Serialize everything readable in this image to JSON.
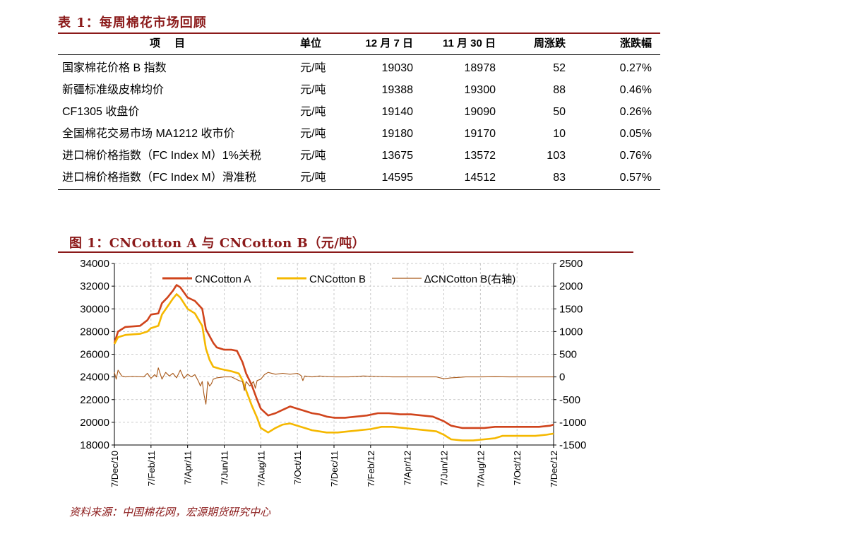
{
  "table": {
    "title": "表 1：每周棉花市场回顾",
    "headers": [
      "项目",
      "单位",
      "12 月 7 日",
      "11 月 30 日",
      "周涨跌",
      "涨跌幅"
    ],
    "rows": [
      [
        "国家棉花价格 B 指数",
        "元/吨",
        "19030",
        "18978",
        "52",
        "0.27%"
      ],
      [
        "新疆标准级皮棉均价",
        "元/吨",
        "19388",
        "19300",
        "88",
        "0.46%"
      ],
      [
        "CF1305 收盘价",
        "元/吨",
        "19140",
        "19090",
        "50",
        "0.26%"
      ],
      [
        "全国棉花交易市场 MA1212 收市价",
        "元/吨",
        "19180",
        "19170",
        "10",
        "0.05%"
      ],
      [
        "进口棉价格指数（FC Index M）1%关税",
        "元/吨",
        "13675",
        "13572",
        "103",
        "0.76%"
      ],
      [
        "进口棉价格指数（FC Index M）滑准税",
        "元/吨",
        "14595",
        "14512",
        "83",
        "0.57%"
      ]
    ]
  },
  "figure": {
    "title": "图 1：CNCotton A 与 CNCotton B（元/吨）",
    "source": "资料来源：中国棉花网，宏源期货研究中心"
  },
  "chart_data": {
    "type": "line",
    "left_axis": {
      "ticks": [
        34000,
        32000,
        30000,
        28000,
        26000,
        24000,
        22000,
        20000,
        18000
      ],
      "ylim": [
        18000,
        34000
      ]
    },
    "right_axis": {
      "ticks": [
        2500,
        2000,
        1500,
        1000,
        500,
        0,
        -500,
        -1000,
        -1500
      ],
      "ylim": [
        -1500,
        2500
      ]
    },
    "x_labels": [
      "7/Dec/10",
      "7/Feb/11",
      "7/Apr/11",
      "7/Jun/11",
      "7/Aug/11",
      "7/Oct/11",
      "7/Dec/11",
      "7/Feb/12",
      "7/Apr/12",
      "7/Jun/12",
      "7/Aug/12",
      "7/Oct/12",
      "7/Dec/12"
    ],
    "grid": "dashed",
    "legend_position": "top",
    "series": [
      {
        "name": "CNCotton A",
        "color": "#d0441c",
        "axis": "left",
        "points": [
          [
            0,
            27000
          ],
          [
            0.1,
            28000
          ],
          [
            0.3,
            28400
          ],
          [
            0.7,
            28500
          ],
          [
            0.9,
            29000
          ],
          [
            1.0,
            29500
          ],
          [
            1.2,
            29600
          ],
          [
            1.3,
            30500
          ],
          [
            1.45,
            31000
          ],
          [
            1.6,
            31600
          ],
          [
            1.7,
            32100
          ],
          [
            1.8,
            31900
          ],
          [
            2.0,
            31000
          ],
          [
            2.2,
            30700
          ],
          [
            2.4,
            30000
          ],
          [
            2.5,
            28200
          ],
          [
            2.7,
            27000
          ],
          [
            2.8,
            26600
          ],
          [
            3.0,
            26400
          ],
          [
            3.2,
            26400
          ],
          [
            3.35,
            26300
          ],
          [
            3.5,
            25300
          ],
          [
            3.6,
            24300
          ],
          [
            3.75,
            23300
          ],
          [
            3.9,
            22000
          ],
          [
            4.0,
            21200
          ],
          [
            4.2,
            20600
          ],
          [
            4.4,
            20800
          ],
          [
            4.6,
            21100
          ],
          [
            4.8,
            21400
          ],
          [
            5.0,
            21200
          ],
          [
            5.2,
            21000
          ],
          [
            5.4,
            20800
          ],
          [
            5.6,
            20700
          ],
          [
            5.8,
            20500
          ],
          [
            6.0,
            20400
          ],
          [
            6.3,
            20400
          ],
          [
            6.6,
            20500
          ],
          [
            6.9,
            20600
          ],
          [
            7.2,
            20800
          ],
          [
            7.5,
            20800
          ],
          [
            7.8,
            20700
          ],
          [
            8.1,
            20700
          ],
          [
            8.4,
            20600
          ],
          [
            8.7,
            20500
          ],
          [
            9.0,
            20100
          ],
          [
            9.2,
            19700
          ],
          [
            9.5,
            19500
          ],
          [
            9.8,
            19500
          ],
          [
            10.1,
            19500
          ],
          [
            10.4,
            19600
          ],
          [
            10.7,
            19600
          ],
          [
            11.0,
            19600
          ],
          [
            11.3,
            19600
          ],
          [
            11.6,
            19600
          ],
          [
            11.9,
            19700
          ],
          [
            12.0,
            19800
          ]
        ]
      },
      {
        "name": "CNCotton B",
        "color": "#f5b800",
        "axis": "left",
        "points": [
          [
            0,
            26900
          ],
          [
            0.1,
            27500
          ],
          [
            0.3,
            27700
          ],
          [
            0.7,
            27800
          ],
          [
            0.9,
            28000
          ],
          [
            1.0,
            28300
          ],
          [
            1.2,
            28500
          ],
          [
            1.3,
            29500
          ],
          [
            1.45,
            30200
          ],
          [
            1.6,
            30900
          ],
          [
            1.7,
            31300
          ],
          [
            1.8,
            31000
          ],
          [
            2.0,
            30000
          ],
          [
            2.2,
            29600
          ],
          [
            2.4,
            28500
          ],
          [
            2.5,
            26500
          ],
          [
            2.6,
            25500
          ],
          [
            2.7,
            24900
          ],
          [
            2.9,
            24700
          ],
          [
            3.2,
            24500
          ],
          [
            3.4,
            24300
          ],
          [
            3.5,
            23700
          ],
          [
            3.6,
            22800
          ],
          [
            3.75,
            21500
          ],
          [
            3.9,
            20400
          ],
          [
            4.0,
            19500
          ],
          [
            4.2,
            19100
          ],
          [
            4.4,
            19500
          ],
          [
            4.6,
            19800
          ],
          [
            4.8,
            19900
          ],
          [
            5.0,
            19700
          ],
          [
            5.2,
            19500
          ],
          [
            5.4,
            19300
          ],
          [
            5.6,
            19200
          ],
          [
            5.8,
            19100
          ],
          [
            6.1,
            19100
          ],
          [
            6.4,
            19200
          ],
          [
            6.7,
            19300
          ],
          [
            7.0,
            19400
          ],
          [
            7.3,
            19600
          ],
          [
            7.6,
            19600
          ],
          [
            7.9,
            19500
          ],
          [
            8.2,
            19400
          ],
          [
            8.5,
            19300
          ],
          [
            8.8,
            19200
          ],
          [
            9.0,
            18900
          ],
          [
            9.2,
            18500
          ],
          [
            9.5,
            18400
          ],
          [
            9.8,
            18400
          ],
          [
            10.1,
            18500
          ],
          [
            10.4,
            18600
          ],
          [
            10.6,
            18800
          ],
          [
            10.9,
            18800
          ],
          [
            11.2,
            18800
          ],
          [
            11.5,
            18800
          ],
          [
            11.8,
            18900
          ],
          [
            12.0,
            19000
          ]
        ]
      },
      {
        "name": "∆CNCotton B(右轴)",
        "color": "#a85818",
        "axis": "right",
        "points": [
          [
            0,
            100
          ],
          [
            0.05,
            -50
          ],
          [
            0.1,
            150
          ],
          [
            0.2,
            20
          ],
          [
            0.3,
            0
          ],
          [
            0.5,
            10
          ],
          [
            0.8,
            0
          ],
          [
            0.9,
            80
          ],
          [
            1.0,
            -30
          ],
          [
            1.1,
            50
          ],
          [
            1.15,
            0
          ],
          [
            1.2,
            200
          ],
          [
            1.3,
            -50
          ],
          [
            1.4,
            100
          ],
          [
            1.5,
            20
          ],
          [
            1.6,
            80
          ],
          [
            1.7,
            -20
          ],
          [
            1.8,
            150
          ],
          [
            1.9,
            -30
          ],
          [
            2.0,
            60
          ],
          [
            2.1,
            0
          ],
          [
            2.2,
            50
          ],
          [
            2.3,
            -100
          ],
          [
            2.35,
            -200
          ],
          [
            2.4,
            -100
          ],
          [
            2.45,
            -400
          ],
          [
            2.5,
            -600
          ],
          [
            2.55,
            -100
          ],
          [
            2.6,
            -200
          ],
          [
            2.65,
            -150
          ],
          [
            2.7,
            -50
          ],
          [
            2.8,
            -20
          ],
          [
            3.0,
            0
          ],
          [
            3.2,
            0
          ],
          [
            3.4,
            -80
          ],
          [
            3.5,
            -100
          ],
          [
            3.55,
            -300
          ],
          [
            3.6,
            -100
          ],
          [
            3.7,
            -200
          ],
          [
            3.8,
            -100
          ],
          [
            3.85,
            -250
          ],
          [
            3.9,
            -80
          ],
          [
            4.0,
            -50
          ],
          [
            4.1,
            50
          ],
          [
            4.2,
            100
          ],
          [
            4.4,
            60
          ],
          [
            4.6,
            80
          ],
          [
            4.8,
            60
          ],
          [
            5.0,
            80
          ],
          [
            5.1,
            30
          ],
          [
            5.15,
            -80
          ],
          [
            5.2,
            20
          ],
          [
            5.4,
            0
          ],
          [
            5.6,
            20
          ],
          [
            5.8,
            10
          ],
          [
            6.0,
            0
          ],
          [
            6.4,
            0
          ],
          [
            6.8,
            20
          ],
          [
            7.2,
            10
          ],
          [
            7.6,
            0
          ],
          [
            8.0,
            0
          ],
          [
            8.4,
            0
          ],
          [
            8.8,
            0
          ],
          [
            9.0,
            -40
          ],
          [
            9.2,
            -20
          ],
          [
            9.4,
            -10
          ],
          [
            9.6,
            0
          ],
          [
            10.0,
            0
          ],
          [
            10.4,
            5
          ],
          [
            10.8,
            0
          ],
          [
            11.2,
            0
          ],
          [
            11.6,
            0
          ],
          [
            12.0,
            0
          ]
        ]
      }
    ]
  }
}
